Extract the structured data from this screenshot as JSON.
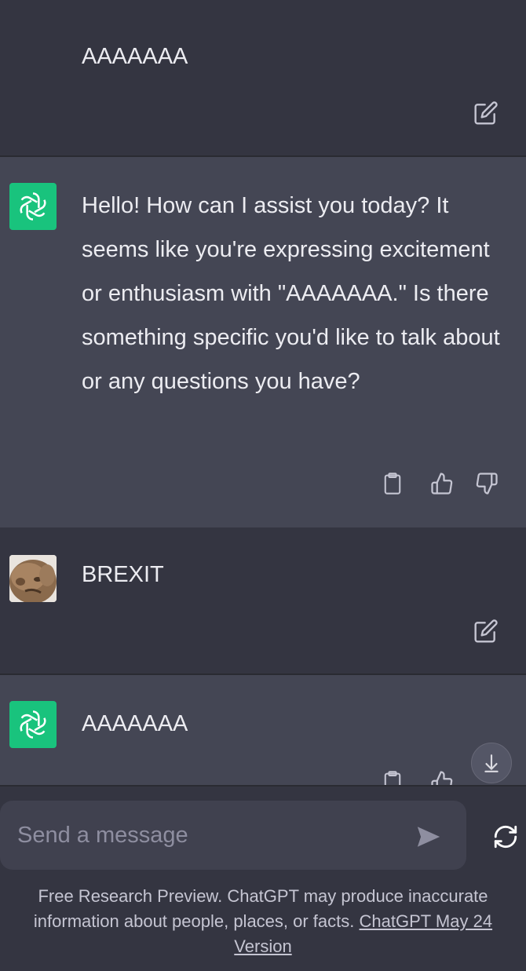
{
  "conversation": {
    "messages": [
      {
        "role": "user",
        "text": "AAAAAAA"
      },
      {
        "role": "assistant",
        "text": "Hello! How can I assist you today? It seems like you're expressing excitement or enthusiasm with \"AAAAAAA.\" Is there something specific you'd like to talk about or any questions you have?"
      },
      {
        "role": "user",
        "text": "BREXIT"
      },
      {
        "role": "assistant",
        "text": "AAAAAAA"
      }
    ]
  },
  "composer": {
    "placeholder": "Send a message",
    "value": ""
  },
  "footer": {
    "text": "Free Research Preview. ChatGPT may produce inaccurate information about people, places, or facts.",
    "link_text": "ChatGPT May 24 Version"
  },
  "colors": {
    "background": "#343541",
    "assistant_bg": "#444654",
    "gpt_green": "#19c37d",
    "input_bg": "#40414f"
  },
  "icons": {
    "edit": "edit-icon",
    "copy": "clipboard-icon",
    "like": "thumbs-up-icon",
    "dislike": "thumbs-down-icon",
    "send": "send-icon",
    "regenerate": "regenerate-icon",
    "scroll": "arrow-down-icon"
  }
}
